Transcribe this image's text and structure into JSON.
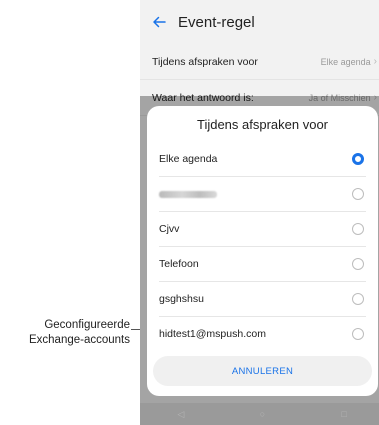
{
  "appbar": {
    "title": "Event-regel",
    "back_icon": "arrow-left"
  },
  "settings": [
    {
      "label": "Tijdens afspraken voor",
      "value": "Elke agenda"
    },
    {
      "label": "Waar het antwoord is:",
      "value": "Ja of Misschien"
    }
  ],
  "dialog": {
    "title": "Tijdens afspraken voor",
    "options": [
      {
        "label": "Elke agenda",
        "selected": true
      },
      {
        "label": "",
        "blurred": true,
        "selected": false
      },
      {
        "label": "Cjvv",
        "selected": false
      },
      {
        "label": "Telefoon",
        "selected": false
      },
      {
        "label": "gsghshsu",
        "selected": false
      },
      {
        "label": "hidtest1@mspush.com",
        "selected": false
      }
    ],
    "cancel_label": "ANNULEREN"
  },
  "navbar": [
    "back",
    "home",
    "recents"
  ],
  "callout": {
    "line1": "Geconfigureerde",
    "line2": "Exchange-accounts"
  },
  "colors": {
    "accent": "#1a73e8",
    "text": "#222222",
    "muted": "#9a9a9a"
  }
}
